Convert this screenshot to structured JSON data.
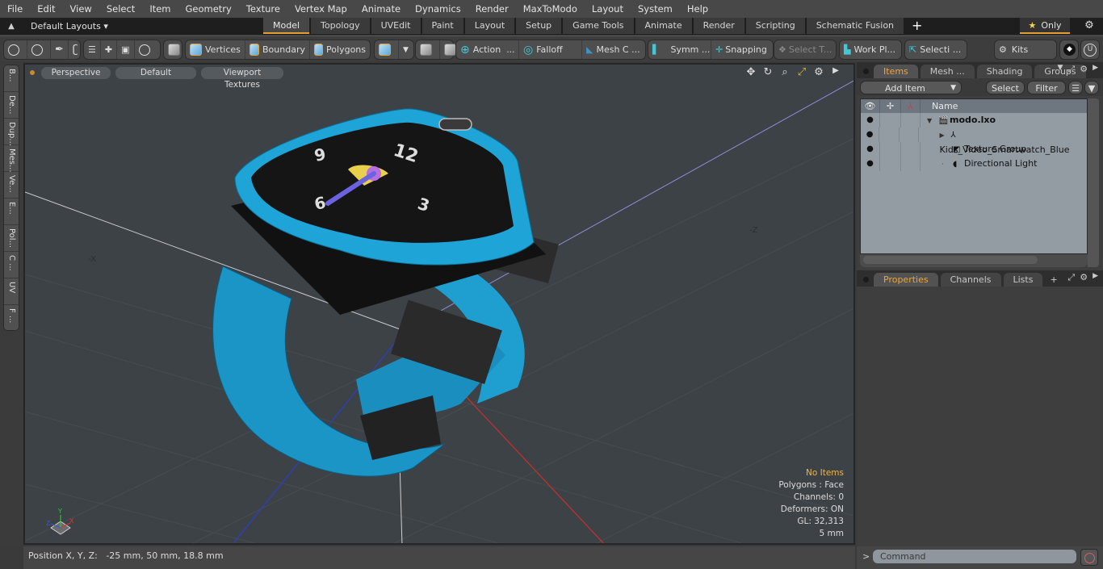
{
  "menu": [
    "File",
    "Edit",
    "View",
    "Select",
    "Item",
    "Geometry",
    "Texture",
    "Vertex Map",
    "Animate",
    "Dynamics",
    "Render",
    "MaxToModo",
    "Layout",
    "System",
    "Help"
  ],
  "layout_selector": "Default Layouts",
  "layout_tabs": [
    {
      "label": "Model",
      "active": true
    },
    {
      "label": "Topology"
    },
    {
      "label": "UVEdit"
    },
    {
      "label": "Paint"
    },
    {
      "label": "Layout"
    },
    {
      "label": "Setup"
    },
    {
      "label": "Game Tools"
    },
    {
      "label": "Animate"
    },
    {
      "label": "Render"
    },
    {
      "label": "Scripting"
    },
    {
      "label": "Schematic Fusion"
    }
  ],
  "only_label": "Only",
  "toolbar": {
    "vertices": "Vertices",
    "boundary": "Boundary",
    "polygons": "Polygons",
    "action": "Action",
    "action_more": "...",
    "falloff": "Falloff",
    "mesh_c": "Mesh C ...",
    "symm": "Symm ...",
    "snapping": "Snapping",
    "select_t": "Select T...",
    "work_pl": "Work Pl...",
    "selecti": "Selecti ...",
    "kits": "Kits"
  },
  "left_tabs": [
    "B...",
    "De...",
    "Dup...",
    "Mes...",
    "Ve...",
    "E...",
    "Pol...",
    "C ...",
    "UV",
    "F ..."
  ],
  "viewport": {
    "view_mode": "Perspective",
    "shading": "Default",
    "textures": "Viewport Textures",
    "axis_x": "-X",
    "axis_z": "-Z",
    "stats": {
      "selection": "No Items",
      "polygons": "Polygons : Face",
      "channels": "Channels: 0",
      "deformers": "Deformers: ON",
      "gl": "GL: 32,313",
      "unit": "5 mm"
    },
    "gizmo": {
      "x": "X",
      "y": "Y",
      "z": "Z"
    }
  },
  "status": {
    "position_label": "Position X, Y, Z:",
    "position_value": "-25 mm, 50 mm, 18.8 mm"
  },
  "items_panel": {
    "tabs": [
      {
        "label": "Items",
        "active": true
      },
      {
        "label": "Mesh ..."
      },
      {
        "label": "Shading"
      },
      {
        "label": "Groups"
      }
    ],
    "add_item": "Add Item",
    "select": "Select",
    "filter": "Filter",
    "column_name": "Name",
    "tree": [
      {
        "label": "modo.lxo",
        "level": 0,
        "bold": true,
        "icon": "scene-icon",
        "expand": "▼"
      },
      {
        "label": "Kids_Video_Smartwatch_Blue",
        "level": 1,
        "icon": "mesh-locator-icon",
        "expand": "▶"
      },
      {
        "label": "Texture Group",
        "level": 1,
        "icon": "texture-group-icon"
      },
      {
        "label": "Directional Light",
        "level": 1,
        "icon": "light-icon"
      }
    ]
  },
  "props_panel": {
    "tabs": [
      {
        "label": "Properties",
        "active": true
      },
      {
        "label": "Channels"
      },
      {
        "label": "Lists"
      }
    ]
  },
  "command": {
    "placeholder": "Command",
    "prompt": ">"
  },
  "colors": {
    "accent": "#e69d31",
    "watch_blue": "#1e9fd0",
    "viewport_bg": "#3d4247"
  }
}
